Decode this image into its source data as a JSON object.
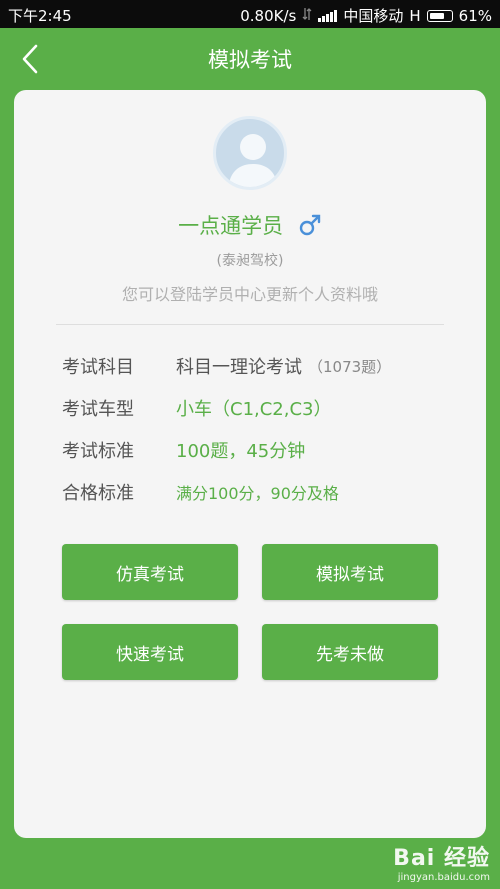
{
  "status_bar": {
    "time": "下午2:45",
    "speed": "0.80K/s",
    "carrier": "中国移动",
    "network": "H",
    "battery": "61%"
  },
  "header": {
    "title": "模拟考试",
    "back_icon": "chevron-left-icon"
  },
  "profile": {
    "avatar_icon": "user-avatar-icon",
    "name": "一点通学员",
    "gender_icon": "male-icon",
    "school": "(泰昶驾校)",
    "hint": "您可以登陆学员中心更新个人资料哦"
  },
  "info": [
    {
      "label": "考试科目",
      "value": "科目一理论考试",
      "extra": "（1073题）"
    },
    {
      "label": "考试车型",
      "value": "小车（C1,C2,C3）"
    },
    {
      "label": "考试标准",
      "value": "100题，45分钟"
    },
    {
      "label": "合格标准",
      "value": "满分100分，90分及格"
    }
  ],
  "buttons": {
    "simulation_real": "仿真考试",
    "mock_exam": "模拟考试",
    "quick_exam": "快速考试",
    "unanswered_first": "先考未做"
  },
  "watermark": {
    "logo": "Bai 经验",
    "url": "jingyan.baidu.com"
  },
  "colors": {
    "primary": "#5aaf48",
    "card": "#f5f5f5",
    "male": "#4a90d9"
  }
}
